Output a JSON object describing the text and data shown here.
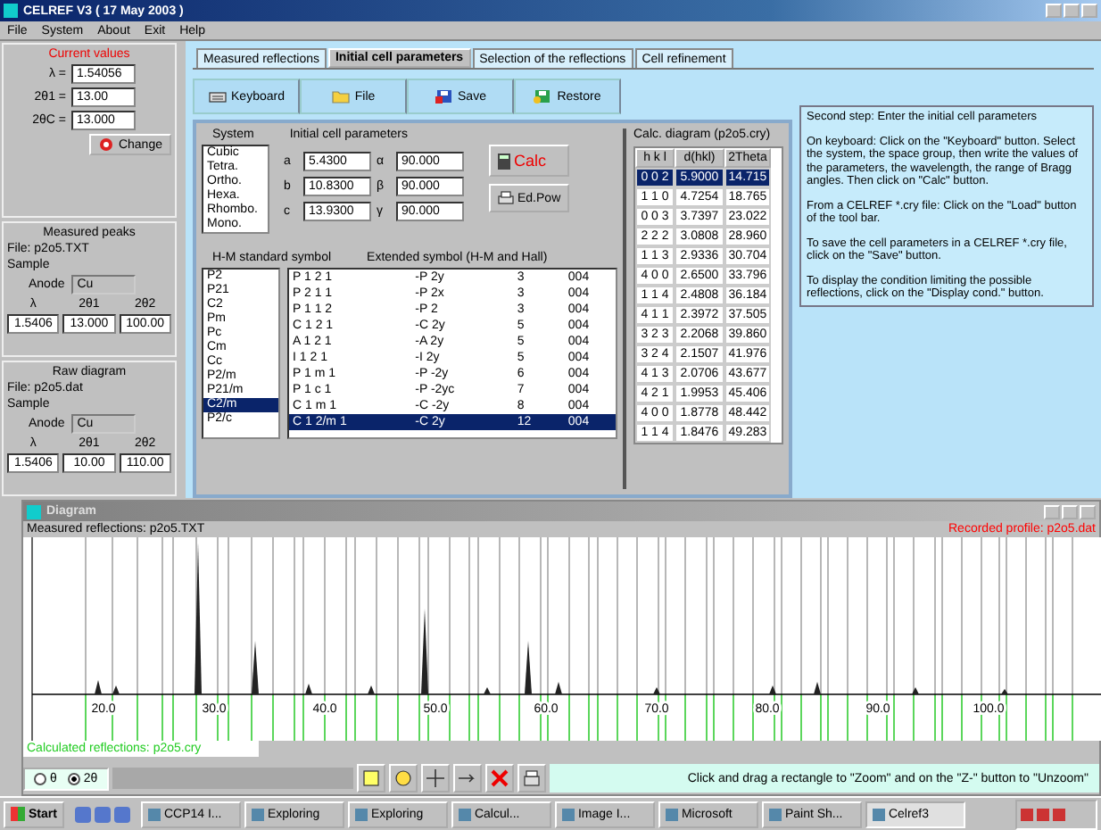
{
  "window": {
    "title": "CELREF V3 ( 17 May 2003 )"
  },
  "menu": [
    "File",
    "System",
    "About",
    "Exit",
    "Help"
  ],
  "current_values": {
    "title": "Current values",
    "rows": [
      {
        "label": "λ =",
        "value": "1.54056"
      },
      {
        "label": "2θ1 =",
        "value": "13.00"
      },
      {
        "label": "2θC =",
        "value": "13.000"
      }
    ],
    "button": "Change"
  },
  "measured_peaks": {
    "title": "Measured peaks",
    "file": "File: p2o5.TXT",
    "sample": "Sample",
    "anode_label": "Anode",
    "anode": "Cu",
    "columns": [
      "λ",
      "2θ1",
      "2θ2"
    ],
    "values": [
      "1.5406",
      "13.000",
      "100.00"
    ]
  },
  "raw_diagram": {
    "title": "Raw diagram",
    "file": "File: p2o5.dat",
    "sample": "Sample",
    "anode_label": "Anode",
    "anode": "Cu",
    "columns": [
      "λ",
      "2θ1",
      "2θ2"
    ],
    "values": [
      "1.5406",
      "10.00",
      "110.00"
    ]
  },
  "tabs": [
    {
      "label": "Measured reflections",
      "selected": false
    },
    {
      "label": "Initial cell parameters",
      "selected": true
    },
    {
      "label": "Selection of the reflections",
      "selected": false
    },
    {
      "label": "Cell refinement",
      "selected": false
    }
  ],
  "toolbar": [
    {
      "label": "Keyboard",
      "kind": "keyboard"
    },
    {
      "label": "File",
      "kind": "file"
    },
    {
      "label": "Save",
      "kind": "save"
    },
    {
      "label": "Restore",
      "kind": "restore"
    }
  ],
  "system": {
    "label": "System",
    "options": [
      {
        "label": "Cubic",
        "selected": false
      },
      {
        "label": "Tetra.",
        "selected": false
      },
      {
        "label": "Ortho.",
        "selected": false
      },
      {
        "label": "Hexa.",
        "selected": false
      },
      {
        "label": "Rhombo.",
        "selected": false
      },
      {
        "label": "Mono.",
        "selected": false
      }
    ]
  },
  "cell": {
    "label": "Initial cell parameters",
    "params": [
      {
        "label": "a",
        "value": "5.4300"
      },
      {
        "label": "α",
        "value": "90.000"
      },
      {
        "label": "b",
        "value": "10.8300"
      },
      {
        "label": "β",
        "value": "90.000"
      },
      {
        "label": "c",
        "value": "13.9300"
      },
      {
        "label": "γ",
        "value": "90.000"
      }
    ]
  },
  "calc_button": "Calc",
  "edit_button": "Ed.Pow",
  "hm": {
    "label": "H-M standard symbol",
    "items": [
      {
        "label": "P2",
        "selected": false
      },
      {
        "label": "P21",
        "selected": false
      },
      {
        "label": "C2",
        "selected": false
      },
      {
        "label": "Pm",
        "selected": false
      },
      {
        "label": "Pc",
        "selected": false
      },
      {
        "label": "Cm",
        "selected": false
      },
      {
        "label": "Cc",
        "selected": false
      },
      {
        "label": "P2/m",
        "selected": false
      },
      {
        "label": "P21/m",
        "selected": false
      },
      {
        "label": "C2/m",
        "selected": true
      },
      {
        "label": "P2/c",
        "selected": false
      }
    ]
  },
  "symbols": {
    "label": "Extended symbol (H-M and Hall)",
    "rows": [
      {
        "cells": [
          "P 1 2 1",
          "-P 2y",
          "3",
          "004"
        ],
        "selected": false
      },
      {
        "cells": [
          "P 2 1 1",
          "-P 2x",
          "3",
          "004"
        ],
        "selected": false
      },
      {
        "cells": [
          "P 1 1 2",
          "-P 2",
          "3",
          "004"
        ],
        "selected": false
      },
      {
        "cells": [
          "C 1 2 1",
          "-C 2y",
          "5",
          "004"
        ],
        "selected": false
      },
      {
        "cells": [
          "A 1 2 1",
          "-A 2y",
          "5",
          "004"
        ],
        "selected": false
      },
      {
        "cells": [
          "I 1 2 1",
          "-I 2y",
          "5",
          "004"
        ],
        "selected": false
      },
      {
        "cells": [
          "P 1 m 1",
          "-P -2y",
          "6",
          "004"
        ],
        "selected": false
      },
      {
        "cells": [
          "P 1 c 1",
          "-P -2yc",
          "7",
          "004"
        ],
        "selected": false
      },
      {
        "cells": [
          "C 1 m 1",
          "-C -2y",
          "8",
          "004"
        ],
        "selected": false
      },
      {
        "cells": [
          "C 1 2/m 1",
          "-C 2y",
          "12",
          "004"
        ],
        "selected": true
      }
    ]
  },
  "calc_diagram": {
    "title": "Calc. diagram (p2o5.cry)",
    "columns": [
      "h k l",
      "d(hkl)",
      "2Theta"
    ],
    "rows": [
      {
        "cells": [
          "0 0 2",
          "5.9000",
          "14.715"
        ],
        "selected": true
      },
      {
        "cells": [
          "1 1 0",
          "4.7254",
          "18.765"
        ],
        "selected": false
      },
      {
        "cells": [
          "0 0 3",
          "3.7397",
          "23.022"
        ],
        "selected": false
      },
      {
        "cells": [
          "2 2 2",
          "3.0808",
          "28.960"
        ],
        "selected": false
      },
      {
        "cells": [
          "1 1 3",
          "2.9336",
          "30.704"
        ],
        "selected": false
      },
      {
        "cells": [
          "4 0 0",
          "2.6500",
          "33.796"
        ],
        "selected": false
      },
      {
        "cells": [
          "1 1 4",
          "2.4808",
          "36.184"
        ],
        "selected": false
      },
      {
        "cells": [
          "4 1 1",
          "2.3972",
          "37.505"
        ],
        "selected": false
      },
      {
        "cells": [
          "3 2 3",
          "2.2068",
          "39.860"
        ],
        "selected": false
      },
      {
        "cells": [
          "3 2 4",
          "2.1507",
          "41.976"
        ],
        "selected": false
      },
      {
        "cells": [
          "4 1 3",
          "2.0706",
          "43.677"
        ],
        "selected": false
      },
      {
        "cells": [
          "4 2 1",
          "1.9953",
          "45.406"
        ],
        "selected": false
      },
      {
        "cells": [
          "4 0 0",
          "1.8778",
          "48.442"
        ],
        "selected": false
      },
      {
        "cells": [
          "1 1 4",
          "1.8476",
          "49.283"
        ],
        "selected": false
      }
    ]
  },
  "help": [
    "Second step: Enter the initial cell parameters",
    "On keyboard: Click on the \"Keyboard\" button. Select the system, the space group, then write the values of the parameters, the wavelength, the range of Bragg angles. Then click on \"Calc\" button.",
    "From a CELREF *.cry file: Click on the \"Load\" button of the tool bar.",
    "To save the cell parameters in a CELREF *.cry file, click on the \"Save\" button.",
    "To display the condition limiting the possible reflections, click on the \"Display cond.\" button."
  ],
  "diagram": {
    "title": "Diagram",
    "left_label": "Measured reflections: p2o5.TXT",
    "right_label": "Recorded profile: p2o5.dat",
    "x_labels": [
      "20.0",
      "30.0",
      "40.0",
      "50.0",
      "60.0",
      "70.0",
      "80.0",
      "90.0",
      "100.0"
    ],
    "calc_label": "Calculated reflections: p2o5.cry",
    "radios": [
      {
        "label": "θ",
        "selected": false
      },
      {
        "label": "2θ",
        "selected": true
      }
    ],
    "status": "Click and drag a rectangle to \"Zoom\" and on the \"Z-\" button to \"Unzoom\""
  },
  "taskbar": {
    "start": "Start",
    "items": [
      {
        "label": "CCP14 I...",
        "selected": false
      },
      {
        "label": "Exploring",
        "selected": false
      },
      {
        "label": "Exploring",
        "selected": false
      },
      {
        "label": "Calcul...",
        "selected": false
      },
      {
        "label": "Image I...",
        "selected": false
      },
      {
        "label": "Microsoft",
        "selected": false
      },
      {
        "label": "Paint Sh...",
        "selected": false
      },
      {
        "label": "Celref3",
        "selected": true
      }
    ]
  }
}
